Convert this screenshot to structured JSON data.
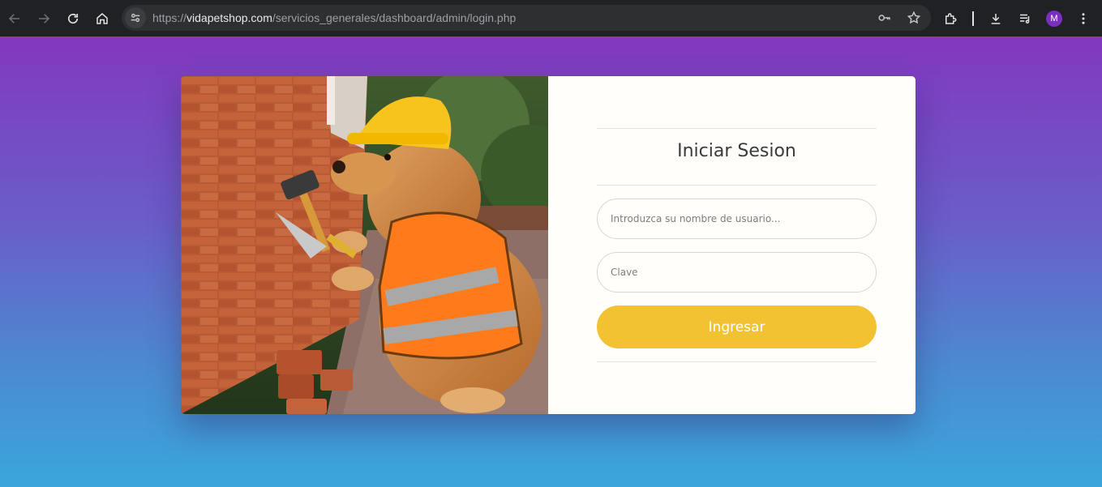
{
  "browser": {
    "url_scheme": "https://",
    "url_host": "vidapetshop.com",
    "url_path": "/servicios_generales/dashboard/admin/login.php",
    "profile_initial": "M",
    "profile_color": "#7b2fbf"
  },
  "login": {
    "title": "Iniciar Sesion",
    "username_placeholder": "Introduzca su nombre de usuario...",
    "password_placeholder": "Clave",
    "submit_label": "Ingresar",
    "accent_color": "#f3c232"
  },
  "icons": [
    "back-icon",
    "forward-icon",
    "reload-icon",
    "home-icon",
    "site-info-icon",
    "key-icon",
    "star-icon",
    "extensions-icon",
    "download-icon",
    "media-icon",
    "menu-icon"
  ]
}
